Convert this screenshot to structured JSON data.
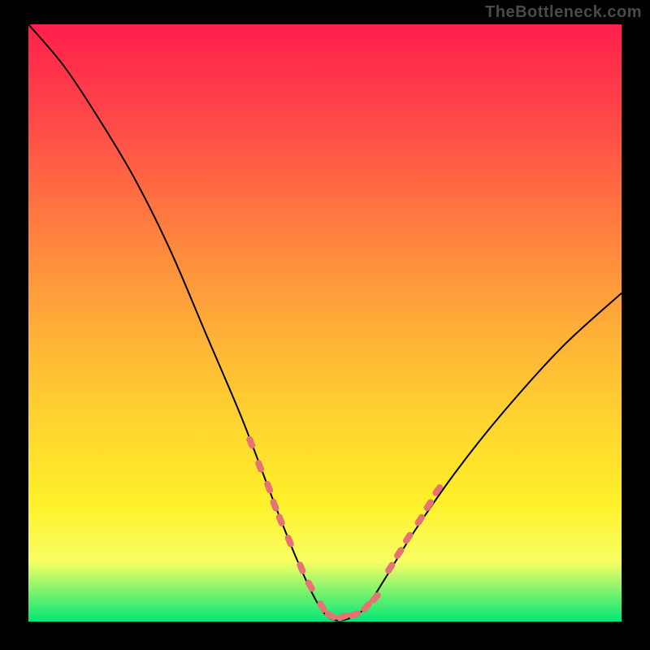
{
  "watermark": "TheBottleneck.com",
  "chart_data": {
    "type": "line",
    "title": "",
    "xlabel": "",
    "ylabel": "",
    "xlim": [
      0,
      100
    ],
    "ylim": [
      0,
      100
    ],
    "grid": false,
    "series": [
      {
        "name": "bottleneck-curve",
        "color": "#000000",
        "x": [
          0,
          6,
          12,
          18,
          24,
          30,
          36,
          41,
          45,
          48.5,
          51,
          54,
          57,
          60,
          65,
          72,
          80,
          90,
          100
        ],
        "y": [
          100,
          93,
          84,
          74,
          62,
          48,
          34,
          21,
          11,
          3.5,
          0.5,
          0.5,
          2.5,
          7,
          15,
          25,
          35,
          46,
          55
        ]
      }
    ],
    "markers": [
      {
        "name": "left-cluster",
        "color": "#e57373",
        "shape": "lozenge",
        "points": [
          {
            "x": 37.5,
            "y": 30
          },
          {
            "x": 39.0,
            "y": 26
          },
          {
            "x": 40.5,
            "y": 22.5
          },
          {
            "x": 41.5,
            "y": 19.5
          },
          {
            "x": 42.5,
            "y": 17
          },
          {
            "x": 44.0,
            "y": 13.5
          },
          {
            "x": 46.0,
            "y": 9
          }
        ]
      },
      {
        "name": "trough-cluster",
        "color": "#e57373",
        "shape": "lozenge",
        "points": [
          {
            "x": 47.5,
            "y": 6
          },
          {
            "x": 49.5,
            "y": 2.5
          },
          {
            "x": 51.0,
            "y": 1.0
          },
          {
            "x": 53.0,
            "y": 0.8
          },
          {
            "x": 55.0,
            "y": 1.2
          },
          {
            "x": 57.0,
            "y": 2.5
          },
          {
            "x": 58.5,
            "y": 4
          }
        ]
      },
      {
        "name": "right-cluster",
        "color": "#e57373",
        "shape": "lozenge",
        "points": [
          {
            "x": 61.0,
            "y": 9
          },
          {
            "x": 62.5,
            "y": 11.5
          },
          {
            "x": 64.0,
            "y": 14
          },
          {
            "x": 66.0,
            "y": 17
          },
          {
            "x": 67.5,
            "y": 19.5
          },
          {
            "x": 69.0,
            "y": 22
          }
        ]
      }
    ],
    "background": {
      "type": "vertical-gradient",
      "stops": [
        {
          "pos": 0,
          "color": "#ff1f4b"
        },
        {
          "pos": 12,
          "color": "#ff3e4a"
        },
        {
          "pos": 24,
          "color": "#ff6044"
        },
        {
          "pos": 38,
          "color": "#ff8a3e"
        },
        {
          "pos": 52,
          "color": "#ffb137"
        },
        {
          "pos": 66,
          "color": "#ffd330"
        },
        {
          "pos": 80,
          "color": "#fff029"
        },
        {
          "pos": 90,
          "color": "#f7ff64"
        },
        {
          "pos": 100,
          "color": "#00e676"
        }
      ]
    }
  }
}
